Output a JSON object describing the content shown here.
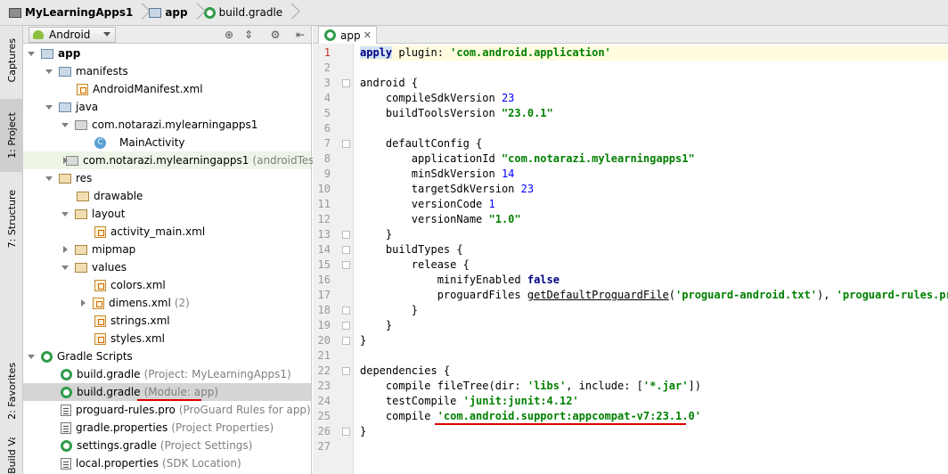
{
  "breadcrumb": {
    "items": [
      {
        "label": "MyLearningApps1",
        "icon": "project-folder-icon"
      },
      {
        "label": "app",
        "icon": "module-folder-icon"
      },
      {
        "label": "build.gradle",
        "icon": "gradle-icon"
      }
    ]
  },
  "side_stripe": {
    "captures": "Captures",
    "project": "1: Project",
    "structure": "7: Structure",
    "favorites": "2: Favorites",
    "variants": "Build Variants"
  },
  "project_panel": {
    "view": "Android",
    "tree": [
      {
        "label": "app",
        "bold": true
      },
      {
        "label": "manifests"
      },
      {
        "label": "AndroidManifest.xml"
      },
      {
        "label": "java"
      },
      {
        "label": "com.notarazi.mylearningapps1"
      },
      {
        "label": "MainActivity"
      },
      {
        "label": "com.notarazi.mylearningapps1",
        "hint": "(androidTest)"
      },
      {
        "label": "res"
      },
      {
        "label": "drawable"
      },
      {
        "label": "layout"
      },
      {
        "label": "activity_main.xml"
      },
      {
        "label": "mipmap"
      },
      {
        "label": "values"
      },
      {
        "label": "colors.xml"
      },
      {
        "label": "dimens.xml",
        "hint": "(2)"
      },
      {
        "label": "strings.xml"
      },
      {
        "label": "styles.xml"
      },
      {
        "label": "Gradle Scripts"
      },
      {
        "label": "build.gradle",
        "hint": "(Project: MyLearningApps1)"
      },
      {
        "label": "build.gradle",
        "hint": "(Module: app)"
      },
      {
        "label": "proguard-rules.pro",
        "hint": "(ProGuard Rules for app)"
      },
      {
        "label": "gradle.properties",
        "hint": "(Project Properties)"
      },
      {
        "label": "settings.gradle",
        "hint": "(Project Settings)"
      },
      {
        "label": "local.properties",
        "hint": "(SDK Location)"
      }
    ]
  },
  "editor": {
    "tab_label": "app",
    "lines": [
      {
        "n": "1"
      },
      {
        "n": "2"
      },
      {
        "n": "3"
      },
      {
        "n": "4"
      },
      {
        "n": "5"
      },
      {
        "n": "6"
      },
      {
        "n": "7"
      },
      {
        "n": "8"
      },
      {
        "n": "9"
      },
      {
        "n": "10"
      },
      {
        "n": "11"
      },
      {
        "n": "12"
      },
      {
        "n": "13"
      },
      {
        "n": "14"
      },
      {
        "n": "15"
      },
      {
        "n": "16"
      },
      {
        "n": "17"
      },
      {
        "n": "18"
      },
      {
        "n": "19"
      },
      {
        "n": "20"
      },
      {
        "n": "21"
      },
      {
        "n": "22"
      },
      {
        "n": "23"
      },
      {
        "n": "24"
      },
      {
        "n": "25"
      },
      {
        "n": "26"
      },
      {
        "n": "27"
      }
    ],
    "code": {
      "l1_kw": "apply",
      "l1_rest": " plugin: ",
      "l1_str": "'com.android.application'",
      "l3": "android {",
      "l4_a": "    compileSdkVersion ",
      "l4_n": "23",
      "l5_a": "    buildToolsVersion ",
      "l5_s": "\"23.0.1\"",
      "l7": "    defaultConfig {",
      "l8_a": "        applicationId ",
      "l8_s": "\"com.notarazi.mylearningapps1\"",
      "l9_a": "        minSdkVersion ",
      "l9_n": "14",
      "l10_a": "        targetSdkVersion ",
      "l10_n": "23",
      "l11_a": "        versionCode ",
      "l11_n": "1",
      "l12_a": "        versionName ",
      "l12_s": "\"1.0\"",
      "l13": "    }",
      "l14": "    buildTypes {",
      "l15": "        release {",
      "l16_a": "            minifyEnabled ",
      "l16_k": "false",
      "l17_a": "            proguardFiles ",
      "l17_f": "getDefaultProguardFile",
      "l17_b": "(",
      "l17_s1": "'proguard-android.txt'",
      "l17_c": "), ",
      "l17_s2": "'proguard-rules.pro'",
      "l18": "        }",
      "l19": "    }",
      "l20": "}",
      "l22": "dependencies {",
      "l23_a": "    compile fileTree(dir: ",
      "l23_s1": "'libs'",
      "l23_b": ", include: [",
      "l23_s2": "'*.jar'",
      "l23_c": "])",
      "l24_a": "    testCompile ",
      "l24_s": "'junit:junit:4.12'",
      "l25_a": "    compile ",
      "l25_s": "'com.android.support:appcompat-v7:23.1.0'",
      "l26": "}"
    }
  },
  "colors": {
    "underline_annotation": "#dd0000",
    "keyword": "#000080",
    "string": "#008000",
    "number": "#0000ff"
  }
}
